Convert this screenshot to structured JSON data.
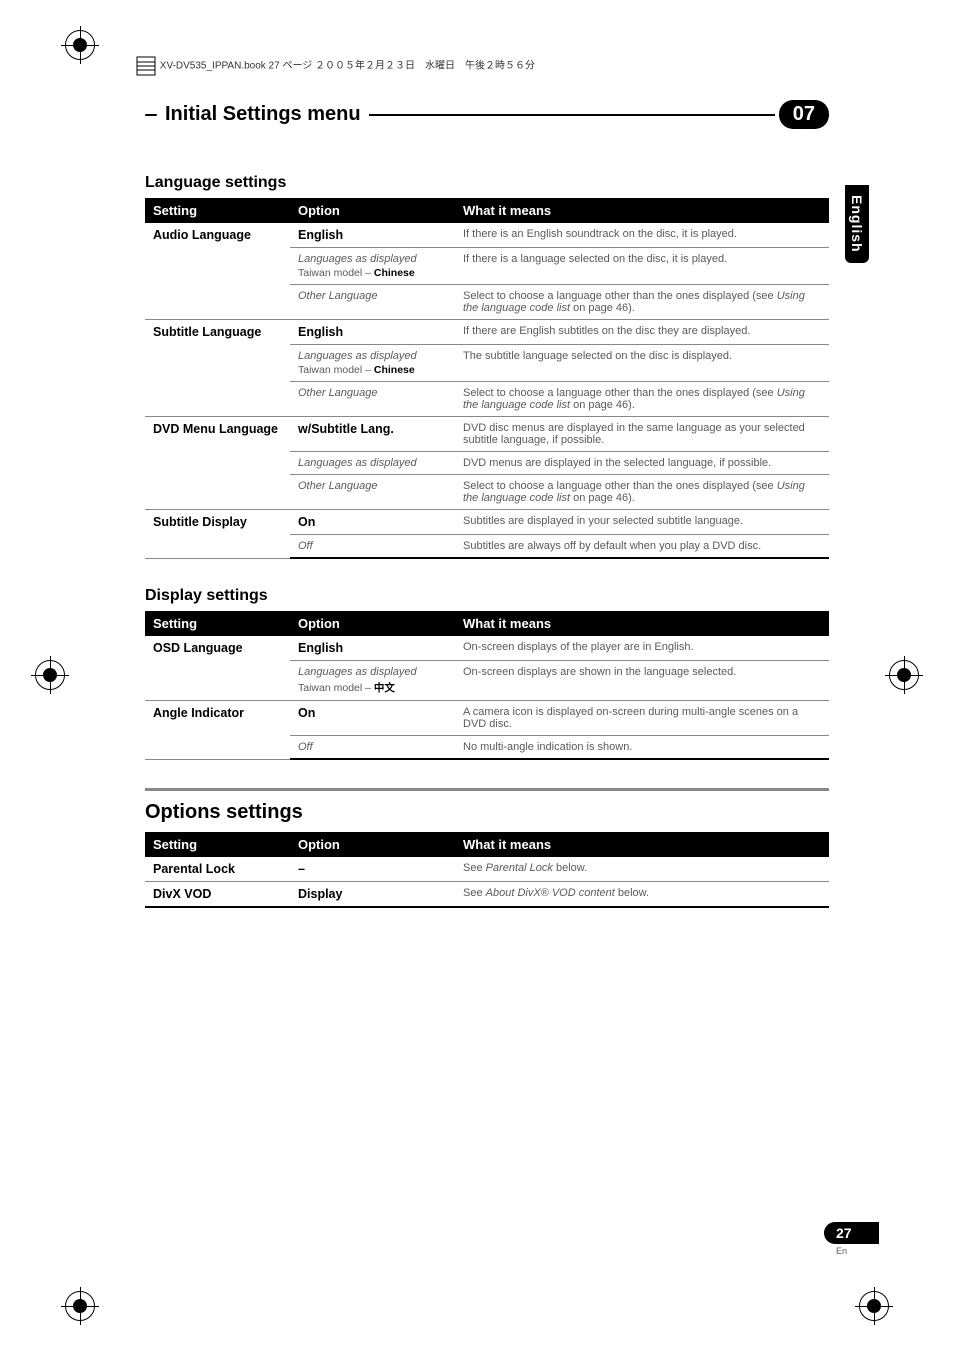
{
  "topHeader": "XV-DV535_IPPAN.book 27 ページ ２００５年２月２３日　水曜日　午後２時５６分",
  "header": {
    "title": "Initial Settings menu",
    "chapter": "07"
  },
  "sideTab": "English",
  "langSettings": {
    "title": "Language settings",
    "headers": {
      "setting": "Setting",
      "option": "Option",
      "meaning": "What it means"
    },
    "groups": [
      {
        "setting": "Audio Language",
        "rows": [
          {
            "optBold": "English",
            "meaning": "If there is an English soundtrack on the disc, it is played."
          },
          {
            "optItalic": "Languages as displayed",
            "optSub": "Taiwan model – ",
            "optSubBold": "Chinese",
            "meaning": "If there is a language selected on the disc, it is played."
          },
          {
            "optItalic": "Other Language",
            "meaningPre": "Select to choose a language other than the ones displayed (see ",
            "meaningItalic": "Using the language code list",
            "meaningPost": " on page 46).",
            "last": true
          }
        ]
      },
      {
        "setting": "Subtitle Language",
        "rows": [
          {
            "optBold": "English",
            "meaning": "If there are English subtitles on the disc they are displayed."
          },
          {
            "optItalic": "Languages as displayed",
            "optSub": "Taiwan model – ",
            "optSubBold": "Chinese",
            "meaning": "The subtitle language selected on the disc is displayed."
          },
          {
            "optItalic": "Other Language",
            "meaningPre": "Select to choose a language other than the ones displayed (see ",
            "meaningItalic": "Using the language code list",
            "meaningPost": " on page 46).",
            "last": true
          }
        ]
      },
      {
        "setting": "DVD Menu Language",
        "rows": [
          {
            "optBold": "w/Subtitle Lang.",
            "meaning": "DVD disc menus are displayed in the same language as your selected subtitle language, if possible."
          },
          {
            "optItalic": "Languages as displayed",
            "meaning": "DVD menus are displayed in the selected language, if possible."
          },
          {
            "optItalic": "Other Language",
            "meaningPre": "Select to choose a language other than the ones displayed (see ",
            "meaningItalic": "Using the language code list",
            "meaningPost": " on page 46).",
            "last": true
          }
        ]
      },
      {
        "setting": "Subtitle Display",
        "rows": [
          {
            "optBold": "On",
            "meaning": "Subtitles are displayed in your selected subtitle language."
          },
          {
            "optItalic": "Off",
            "meaning": "Subtitles are always off by default when you play a DVD disc.",
            "last": true,
            "final": true
          }
        ]
      }
    ]
  },
  "displaySettings": {
    "title": "Display settings",
    "headers": {
      "setting": "Setting",
      "option": "Option",
      "meaning": "What it means"
    },
    "groups": [
      {
        "setting": "OSD Language",
        "rows": [
          {
            "optBold": "English",
            "meaning": "On-screen displays of the player are in English."
          },
          {
            "optItalic": "Languages as displayed",
            "optSub": "Taiwan model –  ",
            "optSubBold": "中文",
            "meaning": "On-screen displays are shown in the language selected.",
            "last": true
          }
        ]
      },
      {
        "setting": "Angle Indicator",
        "rows": [
          {
            "optBold": "On",
            "meaning": "A camera icon is displayed on-screen during multi-angle scenes on a DVD disc."
          },
          {
            "optItalic": "Off",
            "meaning": "No multi-angle indication is shown.",
            "last": true,
            "final": true
          }
        ]
      }
    ]
  },
  "optionsSettings": {
    "title": "Options settings",
    "headers": {
      "setting": "Setting",
      "option": "Option",
      "meaning": "What it means"
    },
    "rows": [
      {
        "setting": "Parental Lock",
        "optBold": "–",
        "meaningPre": "See ",
        "meaningItalic": "Parental Lock",
        "meaningPost": " below."
      },
      {
        "setting": "DivX VOD",
        "optBold": "Display",
        "meaningPre": "See ",
        "meaningItalic": "About DivX® VOD content",
        "meaningPost": " below.",
        "final": true
      }
    ]
  },
  "pageNum": {
    "num": "27",
    "lang": "En"
  }
}
